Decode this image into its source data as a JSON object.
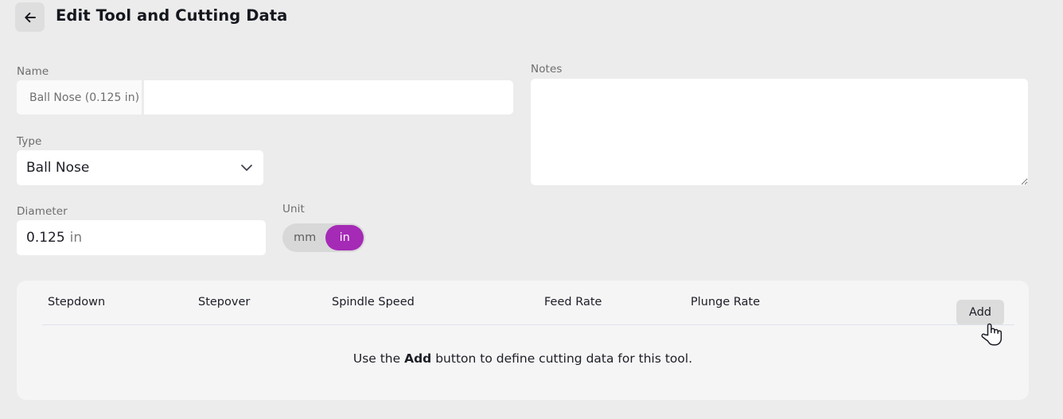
{
  "header": {
    "back_icon": "arrow-left-icon",
    "title": "Edit Tool and Cutting Data"
  },
  "form": {
    "name": {
      "label": "Name",
      "prefix_text": "Ball Nose (0.125 in)",
      "input_value": "",
      "input_placeholder": ""
    },
    "type": {
      "label": "Type",
      "value": "Ball Nose",
      "chevron_icon": "chevron-down-icon",
      "options": [
        "Ball Nose"
      ]
    },
    "diameter": {
      "label": "Diameter",
      "value": "0.125",
      "unit_suffix": "in"
    },
    "unit": {
      "label": "Unit",
      "options": [
        "mm",
        "in"
      ],
      "selected": "in",
      "accent_color": "#a52ab6"
    },
    "notes": {
      "label": "Notes",
      "value": "",
      "placeholder": ""
    }
  },
  "cutting_data": {
    "columns": [
      "Stepdown",
      "Stepover",
      "Spindle Speed",
      "Feed Rate",
      "Plunge Rate"
    ],
    "rows": [],
    "add_button_label": "Add",
    "empty_message_before": "Use the ",
    "empty_message_bold": "Add",
    "empty_message_after": " button to define cutting data for this tool."
  },
  "cursor": {
    "icon": "pointing-hand-cursor"
  }
}
